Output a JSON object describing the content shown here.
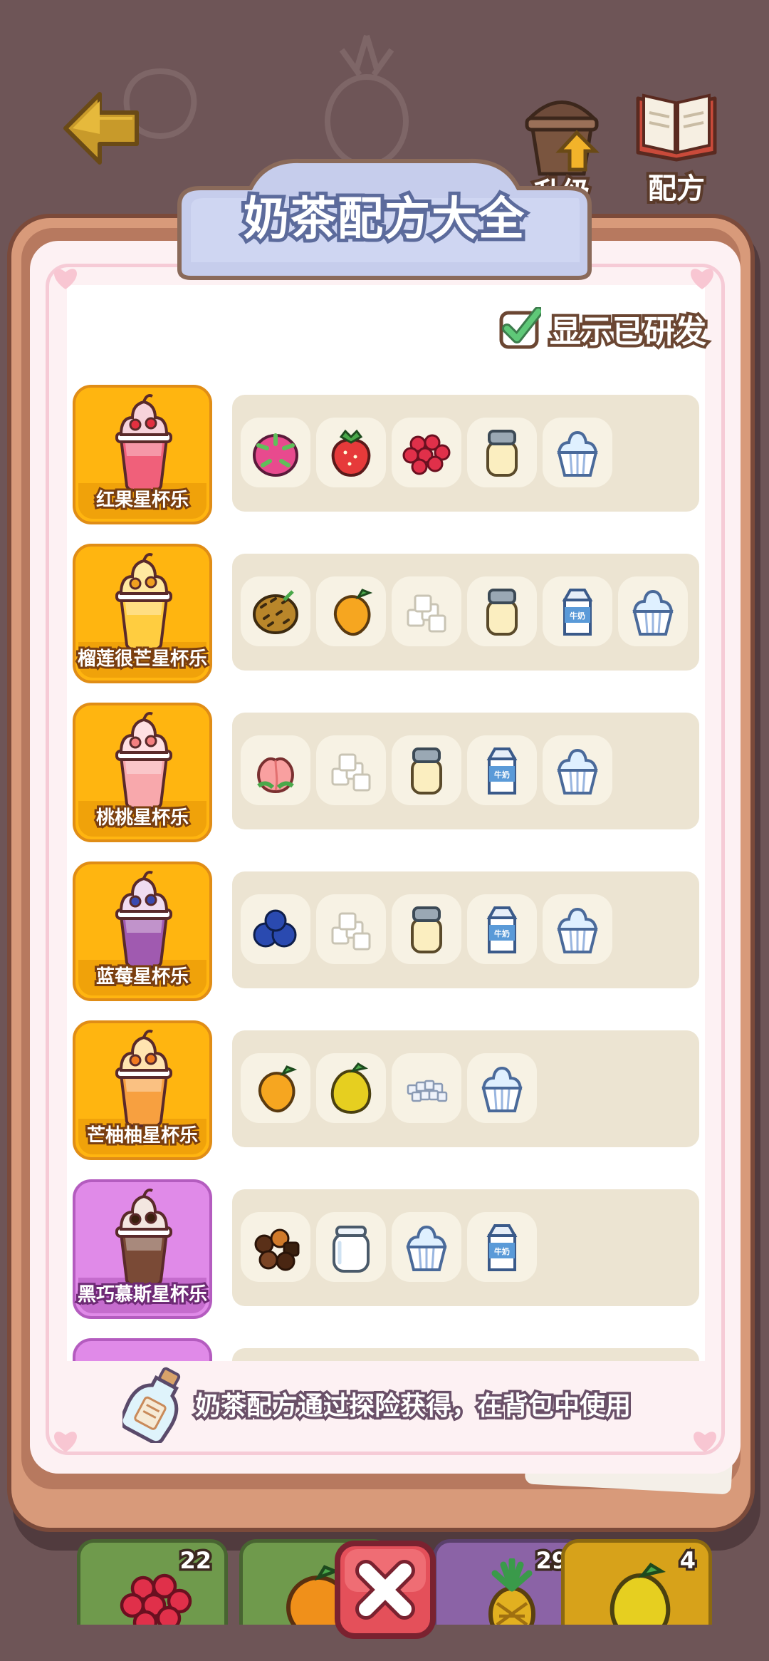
{
  "header": {
    "upgrade_label": "升级",
    "recipes_label": "配方",
    "title": "奶茶配方大全"
  },
  "filter": {
    "show_developed_label": "显示已研发",
    "checked": true
  },
  "recipes": [
    {
      "name": "红果星杯乐",
      "card_color": "yellow",
      "drink": "red-fruit-sundae-drink",
      "ingredients": [
        "dragon-fruit",
        "strawberry",
        "raspberry",
        "condensed-milk-jar",
        "ice-cream-cup"
      ]
    },
    {
      "name": "榴莲很芒星杯乐",
      "card_color": "yellow",
      "drink": "durian-mango-sundae-drink",
      "ingredients": [
        "durian",
        "mango",
        "sugar-cubes",
        "condensed-milk-jar",
        "milk-carton",
        "ice-cream-cup"
      ]
    },
    {
      "name": "桃桃星杯乐",
      "card_color": "yellow",
      "drink": "peach-sundae-drink",
      "ingredients": [
        "peach",
        "sugar-cubes",
        "condensed-milk-jar",
        "milk-carton",
        "ice-cream-cup"
      ]
    },
    {
      "name": "蓝莓星杯乐",
      "card_color": "yellow",
      "drink": "blueberry-sundae-drink",
      "ingredients": [
        "blueberries",
        "sugar-cubes",
        "condensed-milk-jar",
        "milk-carton",
        "ice-cream-cup"
      ]
    },
    {
      "name": "芒柚柚星杯乐",
      "card_color": "yellow",
      "drink": "mango-pomelo-sundae-drink",
      "ingredients": [
        "mango",
        "pomelo",
        "crushed-ice",
        "ice-cream-cup"
      ]
    },
    {
      "name": "黑巧慕斯星杯乐",
      "card_color": "purple",
      "drink": "dark-chocolate-mousse-drink",
      "ingredients": [
        "chocolates",
        "empty-glass-jar",
        "ice-cream-cup",
        "milk-carton"
      ]
    }
  ],
  "milk_carton_text": "牛奶",
  "footer_tip": "奶茶配方通过探险获得，在背包中使用",
  "inventory": [
    {
      "item": "raspberry",
      "count": "22",
      "color": "#6f9a4c"
    },
    {
      "item": "orange",
      "count": "",
      "color": "#6f9a4c"
    },
    {
      "item": "pineapple",
      "count": "29",
      "color": "#8b63a6"
    },
    {
      "item": "pomelo",
      "count": "4",
      "color": "#d7a21a"
    }
  ],
  "colors": {
    "background": "#6e5557",
    "board": "#d89a7a",
    "card_yellow": "#ffb510",
    "card_purple": "#e08ae8",
    "ingredient_strip": "#ece4d2",
    "close_button": "#e4505a"
  }
}
